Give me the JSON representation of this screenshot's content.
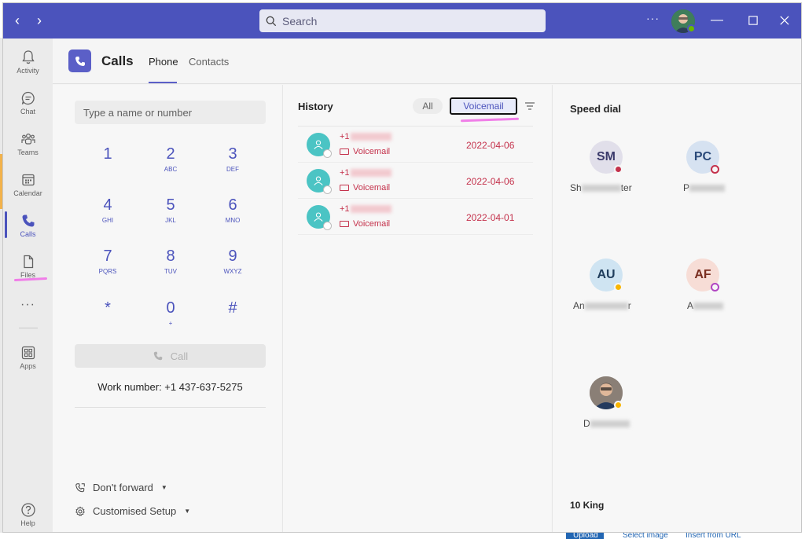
{
  "titlebar": {
    "search_placeholder": "Search",
    "more_label": "···"
  },
  "rail": {
    "items": [
      {
        "label": "Activity",
        "icon": "bell-icon"
      },
      {
        "label": "Chat",
        "icon": "chat-icon"
      },
      {
        "label": "Teams",
        "icon": "teams-icon"
      },
      {
        "label": "Calendar",
        "icon": "calendar-icon"
      },
      {
        "label": "Calls",
        "icon": "phone-icon",
        "active": true
      },
      {
        "label": "Files",
        "icon": "file-icon"
      },
      {
        "label": "Apps",
        "icon": "apps-icon"
      },
      {
        "label": "Help",
        "icon": "help-icon"
      }
    ],
    "more_label": "···"
  },
  "header": {
    "title": "Calls",
    "tabs": [
      {
        "label": "Phone",
        "active": true
      },
      {
        "label": "Contacts",
        "active": false
      }
    ]
  },
  "dialpad": {
    "input_placeholder": "Type a name or number",
    "keys": [
      {
        "digit": "1",
        "letters": ""
      },
      {
        "digit": "2",
        "letters": "ABC"
      },
      {
        "digit": "3",
        "letters": "DEF"
      },
      {
        "digit": "4",
        "letters": "GHI"
      },
      {
        "digit": "5",
        "letters": "JKL"
      },
      {
        "digit": "6",
        "letters": "MNO"
      },
      {
        "digit": "7",
        "letters": "PQRS"
      },
      {
        "digit": "8",
        "letters": "TUV"
      },
      {
        "digit": "9",
        "letters": "WXYZ"
      },
      {
        "digit": "*",
        "letters": ""
      },
      {
        "digit": "0",
        "letters": "+"
      },
      {
        "digit": "#",
        "letters": ""
      }
    ],
    "call_label": "Call",
    "work_number": "Work number: +1 437-637-5275",
    "forward_label": "Don't forward",
    "setup_label": "Customised Setup"
  },
  "history": {
    "title": "History",
    "filter_all": "All",
    "filter_voicemail": "Voicemail",
    "entries": [
      {
        "number_prefix": "+1",
        "type": "Voicemail",
        "date": "2022-04-06"
      },
      {
        "number_prefix": "+1",
        "type": "Voicemail",
        "date": "2022-04-06"
      },
      {
        "number_prefix": "+1",
        "type": "Voicemail",
        "date": "2022-04-01"
      }
    ]
  },
  "speed_dial": {
    "title": "Speed dial",
    "contacts": [
      {
        "initials": "SM",
        "name_start": "Sh",
        "name_end": "ter",
        "status": "busy",
        "bg": "#e1dfea",
        "fg": "#3b3a6b",
        "status_color": "#c4314b"
      },
      {
        "initials": "PC",
        "name_start": "P",
        "name_end": "",
        "status": "offline",
        "bg": "#d6e2f1",
        "fg": "#2b4a7a",
        "status_color": "#c4314b"
      },
      {
        "initials": "AU",
        "name_start": "An",
        "name_end": "r",
        "status": "away",
        "bg": "#cfe4f2",
        "fg": "#1f3d5c",
        "status_color": "#f8b500"
      },
      {
        "initials": "AF",
        "name_start": "A",
        "name_end": "",
        "status": "presenting",
        "bg": "#f7ddd6",
        "fg": "#7a2e20",
        "status_color": "#b146c2"
      },
      {
        "initials": "",
        "name_start": "D",
        "name_end": "",
        "status": "away",
        "photo": true,
        "status_color": "#f8b500"
      }
    ],
    "footer": "10 King"
  },
  "background": {
    "upload": "Upload",
    "select_image": "Select image",
    "insert_url": "Insert from URL"
  },
  "colors": {
    "brand": "#4b53bc",
    "missed_red": "#c4314b",
    "annotation_pink": "#f07ee8"
  }
}
